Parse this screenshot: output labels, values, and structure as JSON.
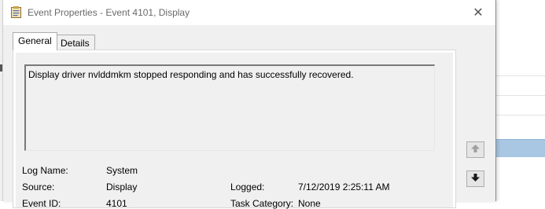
{
  "window": {
    "title": "Event Properties - Event 4101, Display",
    "close_glyph": "✕"
  },
  "tabs": [
    {
      "label": "General",
      "active": true
    },
    {
      "label": "Details",
      "active": false
    }
  ],
  "general": {
    "description": "Display driver nvlddmkm stopped responding and has successfully recovered.",
    "fields": {
      "log_name_label": "Log Name:",
      "log_name_value": "System",
      "source_label": "Source:",
      "source_value": "Display",
      "logged_label": "Logged:",
      "logged_value": "7/12/2019 2:25:11 AM",
      "event_id_label": "Event ID:",
      "event_id_value": "4101",
      "task_category_label": "Task Category:",
      "task_category_value": "None"
    }
  },
  "nav": {
    "up_icon": "arrow-up-icon",
    "down_icon": "arrow-down-icon"
  },
  "colors": {
    "dialog_bg": "#f0f0f0",
    "selection_bg": "#a9c6e3",
    "title_text": "#6a6a6a"
  }
}
